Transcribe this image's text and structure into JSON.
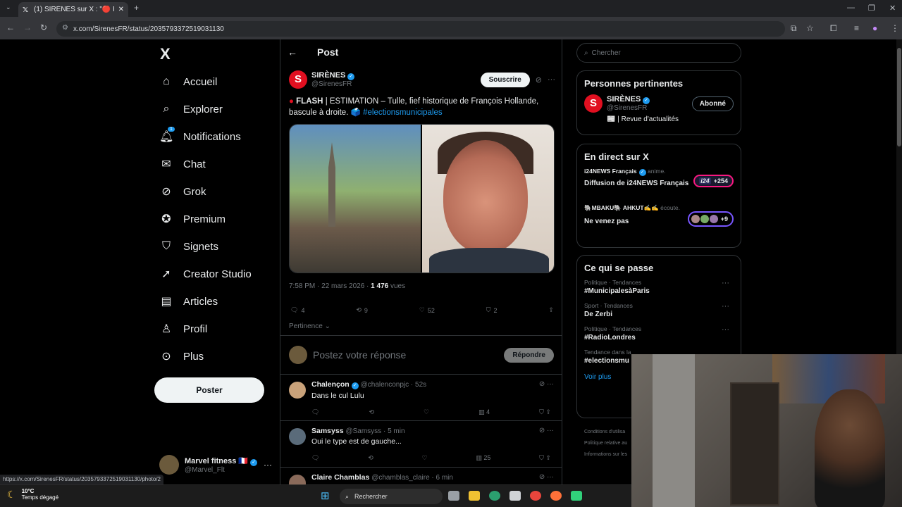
{
  "browser": {
    "tab_title": "(1) SIRÈNES sur X : \"🔴 FLASH |",
    "url": "x.com/SirenesFR/status/2035793372519031130",
    "status_url": "https://x.com/SirenesFR/status/2035793372519031130/photo/2"
  },
  "sidebar": {
    "logo": "X",
    "items": [
      {
        "label": "Accueil",
        "icon": "home-icon"
      },
      {
        "label": "Explorer",
        "icon": "search-icon"
      },
      {
        "label": "Notifications",
        "icon": "bell-icon",
        "badge": "1"
      },
      {
        "label": "Chat",
        "icon": "mail-icon"
      },
      {
        "label": "Grok",
        "icon": "grok-icon"
      },
      {
        "label": "Premium",
        "icon": "verified-icon"
      },
      {
        "label": "Signets",
        "icon": "bookmark-icon"
      },
      {
        "label": "Creator Studio",
        "icon": "rocket-icon"
      },
      {
        "label": "Articles",
        "icon": "article-icon"
      },
      {
        "label": "Profil",
        "icon": "person-icon"
      },
      {
        "label": "Plus",
        "icon": "more-icon"
      }
    ],
    "post_button": "Poster",
    "profile": {
      "name": "Marvel fitness 🇫🇷",
      "handle": "@Marvel_Flt"
    }
  },
  "post": {
    "header": "Post",
    "author": {
      "name": "SIRÈNES",
      "handle": "@SirenesFR",
      "initial": "S"
    },
    "subscribe": "Souscrire",
    "text_flash": "FLASH",
    "text_body": " | ESTIMATION – Tulle, fief historique de François Hollande, bascule à droite. 🗳️ ",
    "hashtag": "#electionsmunicipales",
    "time": "7:58 PM · 22 mars 2026 · ",
    "views_count": "1 476",
    "views_label": " vues",
    "actions": {
      "replies": "4",
      "reposts": "9",
      "likes": "52",
      "bookmarks": "2"
    },
    "sort_label": "Pertinence"
  },
  "reply_box": {
    "placeholder": "Postez votre réponse",
    "button": "Répondre"
  },
  "comments": [
    {
      "name": "Chalençon",
      "handle": "@chalenconpjc · 52s",
      "text": "Dans le cul Lulu",
      "views": "4",
      "avatar_color": "#c9a27a"
    },
    {
      "name": "Samsyss",
      "handle": "@Samsyss · 5 min",
      "text": "Oui le type est de gauche...",
      "views": "25",
      "avatar_color": "#5a6b7a"
    },
    {
      "name": "Claire Chamblas",
      "handle": "@chamblas_claire · 6 min",
      "text": "",
      "views": "",
      "avatar_color": "#8a6a5a"
    }
  ],
  "right": {
    "search_placeholder": "Chercher",
    "relevant": {
      "title": "Personnes pertinentes",
      "name": "SIRÈNES",
      "handle": "@SirenesFR",
      "bio": "📰 | Revue d'actualités",
      "button": "Abonné"
    },
    "live": {
      "title": "En direct sur X",
      "items": [
        {
          "host": "i24NEWS Français",
          "status": "anime.",
          "title": "Diffusion de i24NEWS Français",
          "pill_logo": "i24",
          "pill": "+254"
        },
        {
          "host": "🐘MBAKU🐘 AHKUT✍️✍️",
          "status": "écoute.",
          "title": "Ne venez pas",
          "pill": "+9"
        }
      ]
    },
    "trends": {
      "title": "Ce qui se passe",
      "items": [
        {
          "category": "Politique · Tendances",
          "name": "#MunicipalesàParis"
        },
        {
          "category": "Sport · Tendances",
          "name": "De Zerbi"
        },
        {
          "category": "Politique · Tendances",
          "name": "#RadioLondres"
        },
        {
          "category": "Tendance dans la",
          "name": "#electionsmu"
        }
      ],
      "more": "Voir plus"
    },
    "footer": [
      "Conditions d'utilisa",
      "Politique relative au",
      "Informations sur les"
    ]
  },
  "taskbar": {
    "temp": "10°C",
    "weather": "Temps dégagé",
    "search": "Rechercher"
  },
  "colors": {
    "accent": "#1d9bf0",
    "brand_red": "#e10f20",
    "live_pink": "#f91880",
    "live_purple": "#7856ff"
  }
}
